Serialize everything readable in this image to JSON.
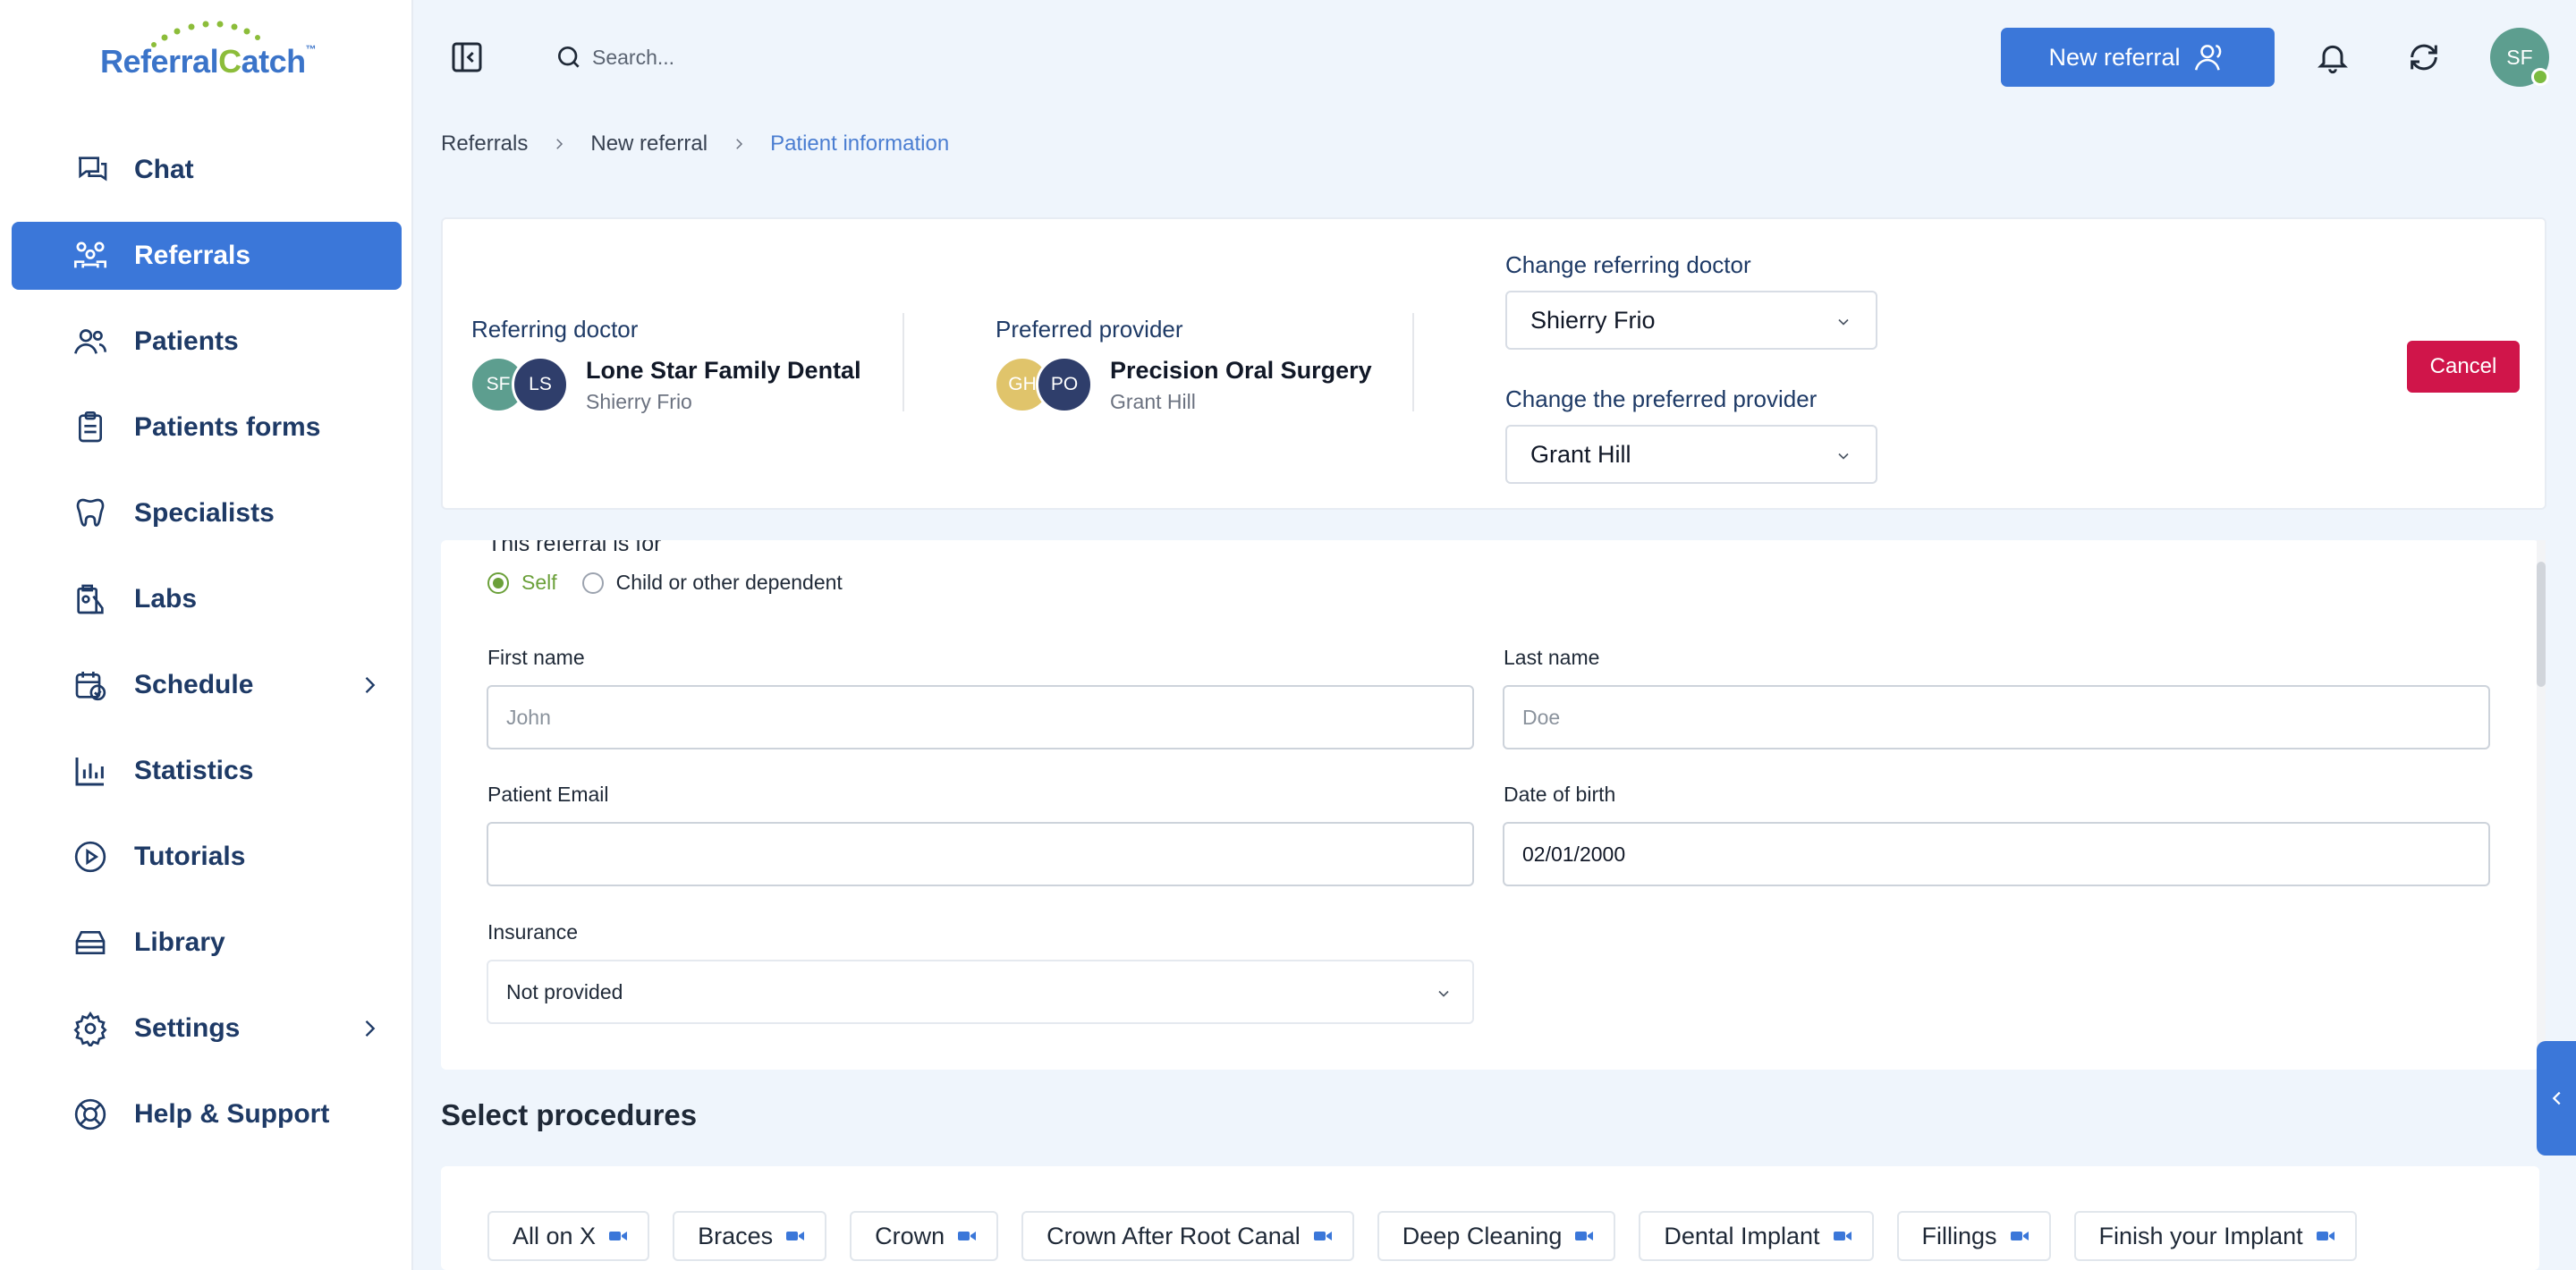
{
  "app": {
    "logo_text_1": "Referral",
    "logo_text_c": "C",
    "logo_text_2": "atch",
    "logo_tm": "™"
  },
  "sidebar": {
    "items": [
      {
        "label": "Chat",
        "icon": "chat-icon",
        "active": false
      },
      {
        "label": "Referrals",
        "icon": "users-icon",
        "active": true
      },
      {
        "label": "Patients",
        "icon": "patients-icon",
        "active": false
      },
      {
        "label": "Patients forms",
        "icon": "clipboard-icon",
        "active": false
      },
      {
        "label": "Specialists",
        "icon": "tooth-icon",
        "active": false
      },
      {
        "label": "Labs",
        "icon": "lab-icon",
        "active": false
      },
      {
        "label": "Schedule",
        "icon": "calendar-icon",
        "active": false,
        "expandable": true
      },
      {
        "label": "Statistics",
        "icon": "bar-chart-icon",
        "active": false
      },
      {
        "label": "Tutorials",
        "icon": "play-icon",
        "active": false
      },
      {
        "label": "Library",
        "icon": "library-icon",
        "active": false
      },
      {
        "label": "Settings",
        "icon": "gear-icon",
        "active": false,
        "expandable": true
      },
      {
        "label": "Help & Support",
        "icon": "lifebuoy-icon",
        "active": false
      }
    ]
  },
  "topbar": {
    "search_placeholder": "Search...",
    "new_referral_label": "New referral",
    "user_initials": "SF"
  },
  "breadcrumb": {
    "items": [
      "Referrals",
      "New referral",
      "Patient information"
    ]
  },
  "referral_header": {
    "referring_doctor_label": "Referring doctor",
    "referring_avatar_1": "SF",
    "referring_avatar_2": "LS",
    "referring_name": "Lone Star Family Dental",
    "referring_sub": "Shierry Frio",
    "preferred_provider_label": "Preferred provider",
    "provider_avatar_1": "GH",
    "provider_avatar_2": "PO",
    "provider_name": "Precision Oral Surgery",
    "provider_sub": "Grant Hill",
    "change_doctor_label": "Change referring doctor",
    "change_doctor_value": "Shierry Frio",
    "change_provider_label": "Change the preferred provider",
    "change_provider_value": "Grant Hill",
    "cancel_label": "Cancel"
  },
  "form": {
    "title": "This referral is for",
    "radio_self": "Self",
    "radio_other": "Child or other dependent",
    "first_name_label": "First name",
    "first_name_placeholder": "John",
    "last_name_label": "Last name",
    "last_name_placeholder": "Doe",
    "email_label": "Patient Email",
    "email_value": "",
    "dob_label": "Date of birth",
    "dob_value": "02/01/2000",
    "insurance_label": "Insurance",
    "insurance_value": "Not provided"
  },
  "procedures": {
    "title": "Select procedures",
    "items": [
      "All on X",
      "Braces",
      "Crown",
      "Crown After Root Canal",
      "Deep Cleaning",
      "Dental Implant",
      "Fillings",
      "Finish your Implant"
    ]
  },
  "colors": {
    "accent": "#3b77d9",
    "brand_green": "#8cbd3a",
    "danger": "#d0154a",
    "background": "#eff5fc"
  }
}
